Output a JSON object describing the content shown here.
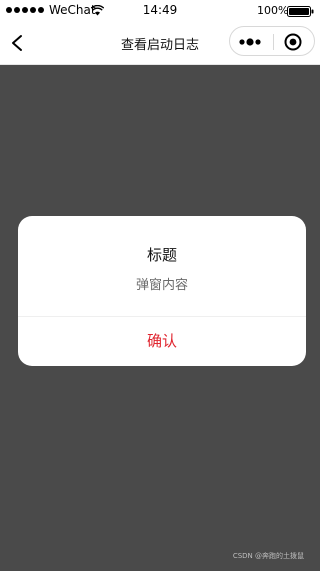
{
  "status_bar": {
    "carrier": "WeChat",
    "time": "14:49",
    "battery": "100%",
    "icons": [
      "signal-dots-icon",
      "wifi-icon",
      "battery-icon"
    ]
  },
  "nav": {
    "title": "查看启动日志",
    "icons": [
      "back-arrow-icon",
      "more-dots-icon",
      "close-circle-icon"
    ]
  },
  "modal": {
    "title": "标题",
    "content": "弹窗内容",
    "confirm_label": "确认",
    "confirm_color": "#e0252f"
  },
  "watermark": "CSDN @奔跑的土拨鼠",
  "colors": {
    "overlay": "#4a4a4a",
    "surface": "#ffffff",
    "accent": "#e0252f"
  }
}
